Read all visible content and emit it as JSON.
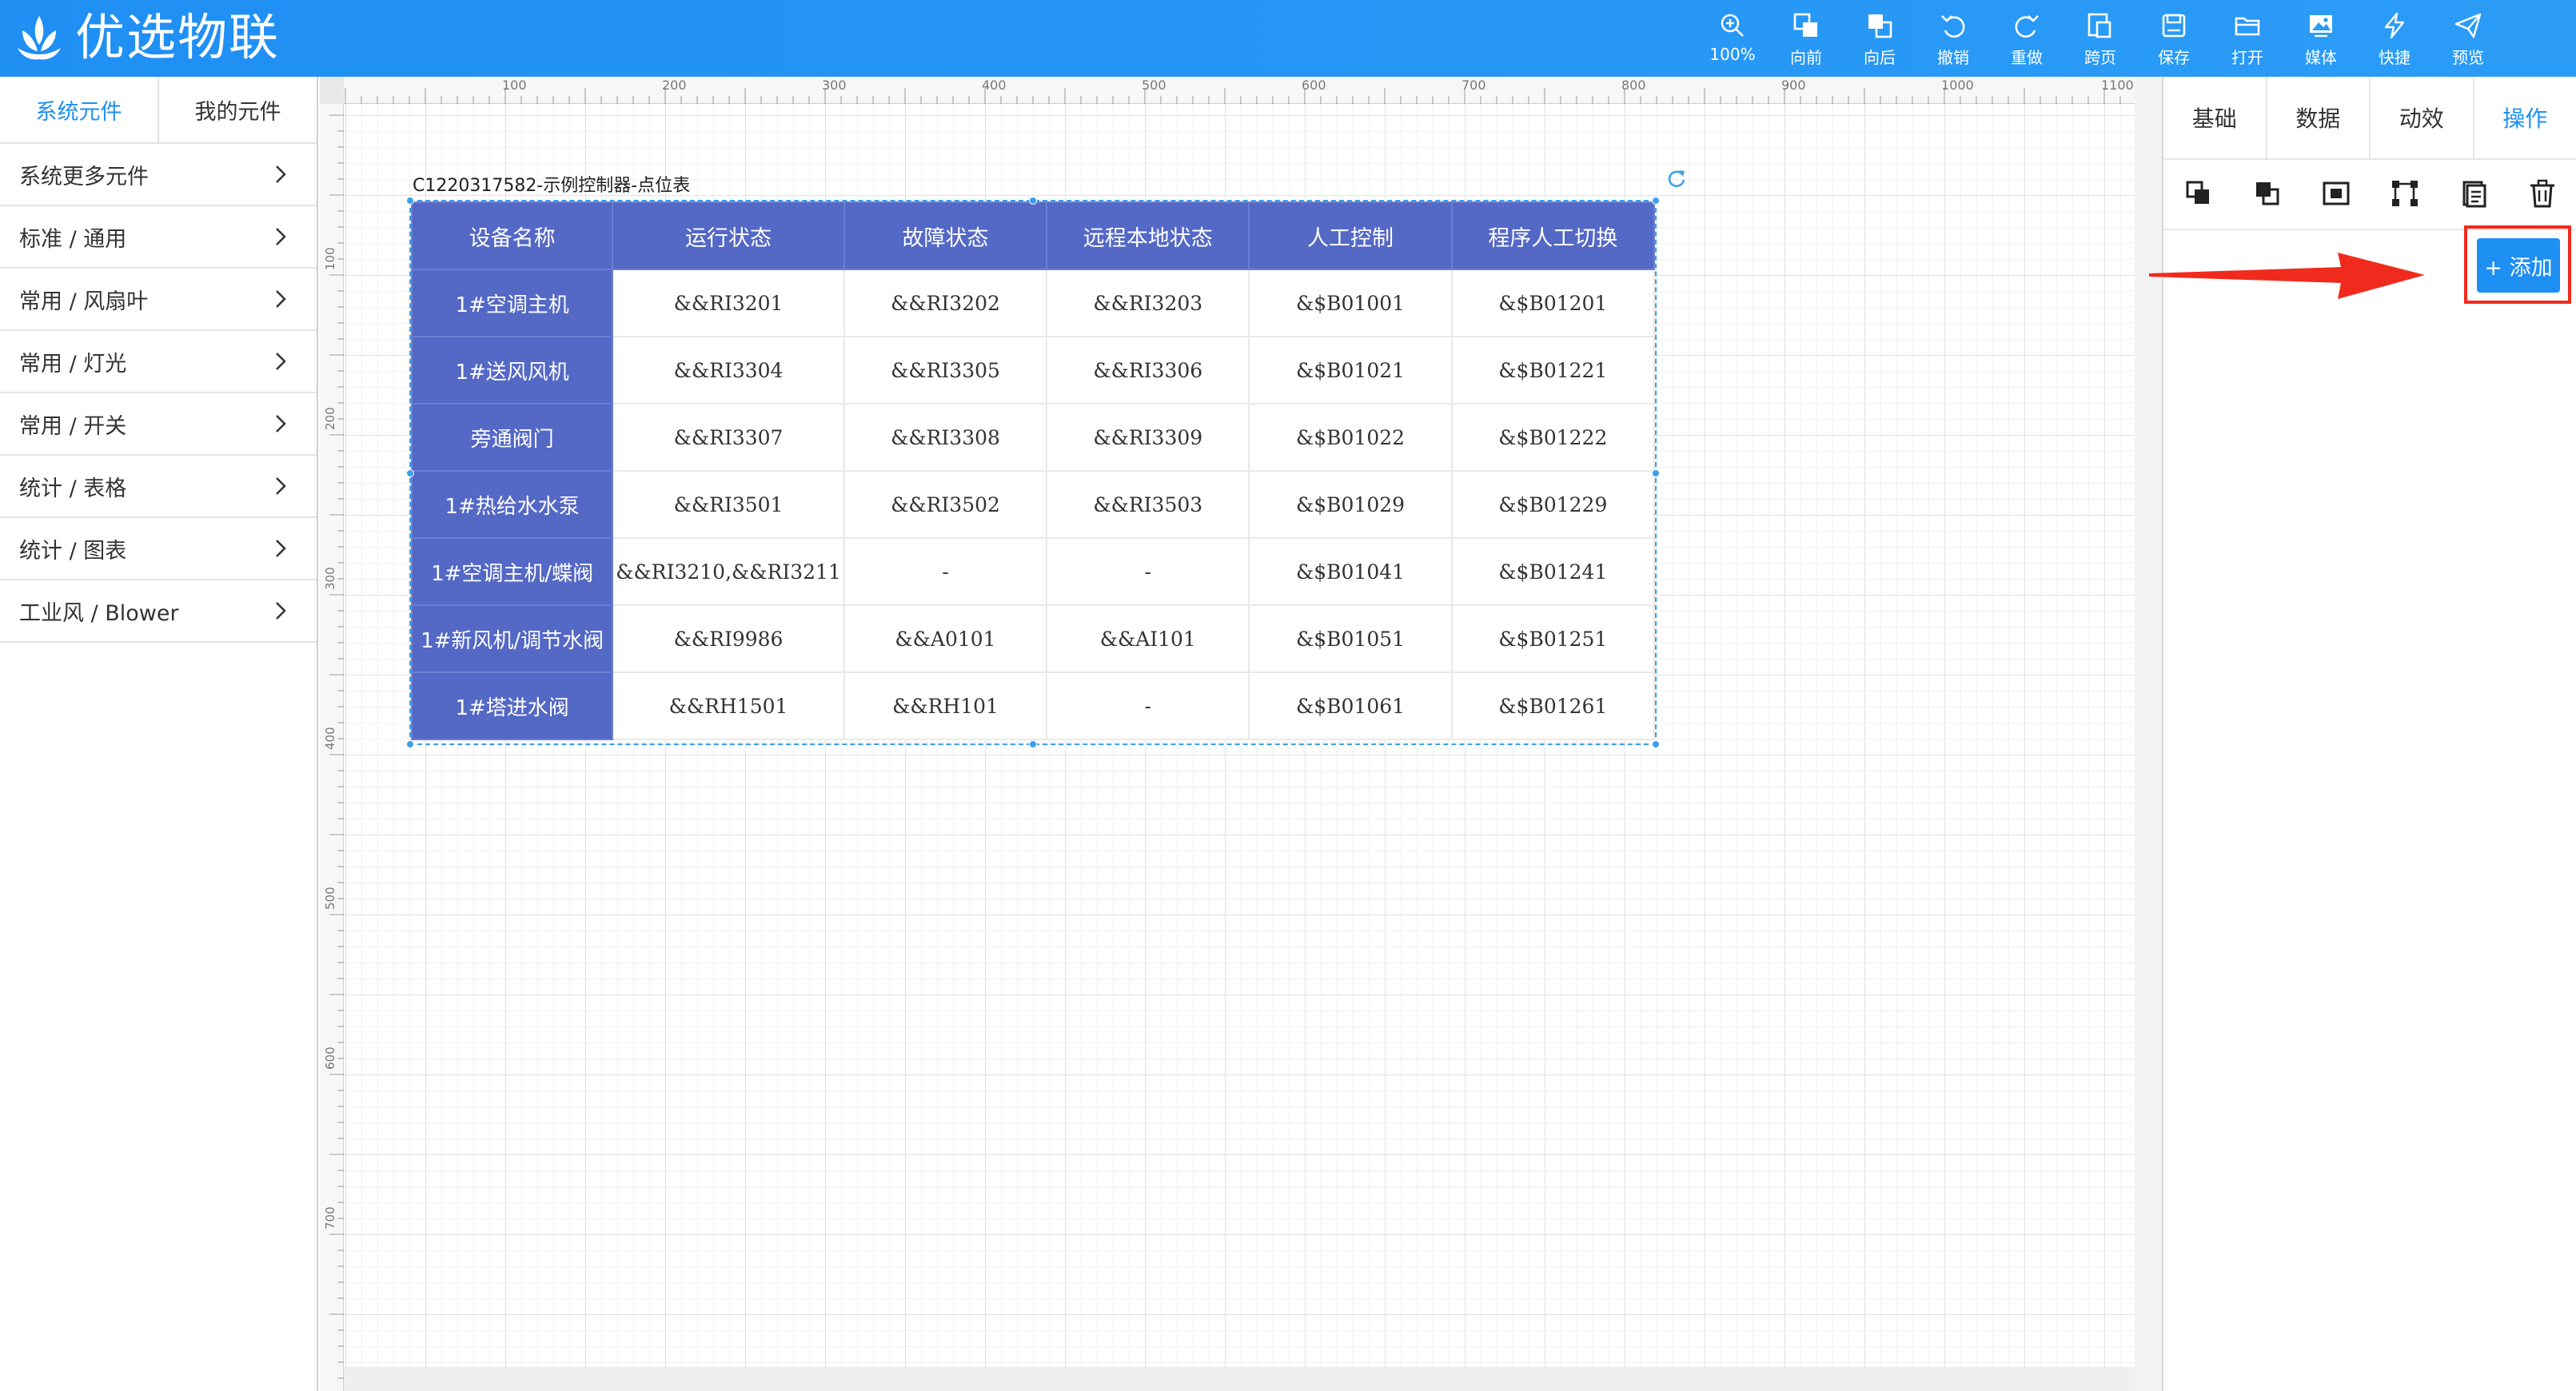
{
  "app": {
    "title": "优选物联"
  },
  "toolbar": [
    {
      "icon": "zoom-in-icon",
      "label": "100%"
    },
    {
      "icon": "bring-forward-icon",
      "label": "向前"
    },
    {
      "icon": "send-backward-icon",
      "label": "向后"
    },
    {
      "icon": "undo-icon",
      "label": "撤销"
    },
    {
      "icon": "redo-icon",
      "label": "重做"
    },
    {
      "icon": "cross-page-icon",
      "label": "跨页"
    },
    {
      "icon": "save-icon",
      "label": "保存"
    },
    {
      "icon": "open-folder-icon",
      "label": "打开"
    },
    {
      "icon": "media-icon",
      "label": "媒体"
    },
    {
      "icon": "lightning-icon",
      "label": "快捷"
    },
    {
      "icon": "send-icon",
      "label": "预览"
    }
  ],
  "left_panel": {
    "tabs": [
      "系统元件",
      "我的元件"
    ],
    "items": [
      "系统更多元件",
      "标准 / 通用",
      "常用 / 风扇叶",
      "常用 / 灯光",
      "常用 / 开关",
      "统计 / 表格",
      "统计 / 图表",
      "工业风 / Blower"
    ]
  },
  "rulers": {
    "top_labels": [
      "100",
      "200",
      "300",
      "400",
      "500",
      "600",
      "700",
      "800",
      "900",
      "1000",
      "1100"
    ],
    "left_labels": [
      "100",
      "200",
      "300",
      "400",
      "500",
      "600",
      "700"
    ]
  },
  "component": {
    "title": "C1220317582-示例控制器-点位表",
    "headers": [
      "设备名称",
      "运行状态",
      "故障状态",
      "远程本地状态",
      "人工控制",
      "程序人工切换"
    ],
    "rows": [
      [
        "1#空调主机",
        "&&RI3201",
        "&&RI3202",
        "&&RI3203",
        "&$B01001",
        "&$B01201"
      ],
      [
        "1#送风风机",
        "&&RI3304",
        "&&RI3305",
        "&&RI3306",
        "&$B01021",
        "&$B01221"
      ],
      [
        "旁通阀门",
        "&&RI3307",
        "&&RI3308",
        "&&RI3309",
        "&$B01022",
        "&$B01222"
      ],
      [
        "1#热给水水泵",
        "&&RI3501",
        "&&RI3502",
        "&&RI3503",
        "&$B01029",
        "&$B01229"
      ],
      [
        "1#空调主机/蝶阀",
        "&&RI3210,&&RI3211",
        "-",
        "-",
        "&$B01041",
        "&$B01241"
      ],
      [
        "1#新风机/调节水阀",
        "&&RI9986",
        "&&A0101",
        "&&AI101",
        "&$B01051",
        "&$B01251"
      ],
      [
        "1#塔进水阀",
        "&&RH1501",
        "&&RH101",
        "-",
        "&$B01061",
        "&$B01261"
      ]
    ]
  },
  "right_panel": {
    "tabs": [
      "基础",
      "数据",
      "动效",
      "操作"
    ],
    "active_tab": "操作",
    "icons": [
      "copy-icon",
      "paste-layer-icon",
      "fit-icon",
      "connect-nodes-icon",
      "clipboard-icon",
      "trash-icon"
    ],
    "add_button": "+ 添加"
  },
  "colors": {
    "header": "#1f8ff4",
    "accent": "#1e8ff3",
    "table_header": "#5468c5",
    "highlight": "#f02b1e"
  }
}
